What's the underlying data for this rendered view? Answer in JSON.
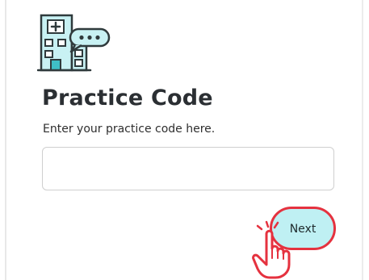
{
  "header": {
    "icon": "hospital-chat-icon",
    "title": "Practice Code",
    "subtitle": "Enter your practice code here."
  },
  "form": {
    "practice_code_value": "",
    "practice_code_placeholder": ""
  },
  "actions": {
    "next_label": "Next"
  },
  "pointer": {
    "icon": "pointing-hand-icon"
  },
  "colors": {
    "accent_teal": "#3fbfc6",
    "button_fill": "#bff0f3",
    "highlight_red": "#e5323f",
    "title_text": "#2b2f33"
  }
}
